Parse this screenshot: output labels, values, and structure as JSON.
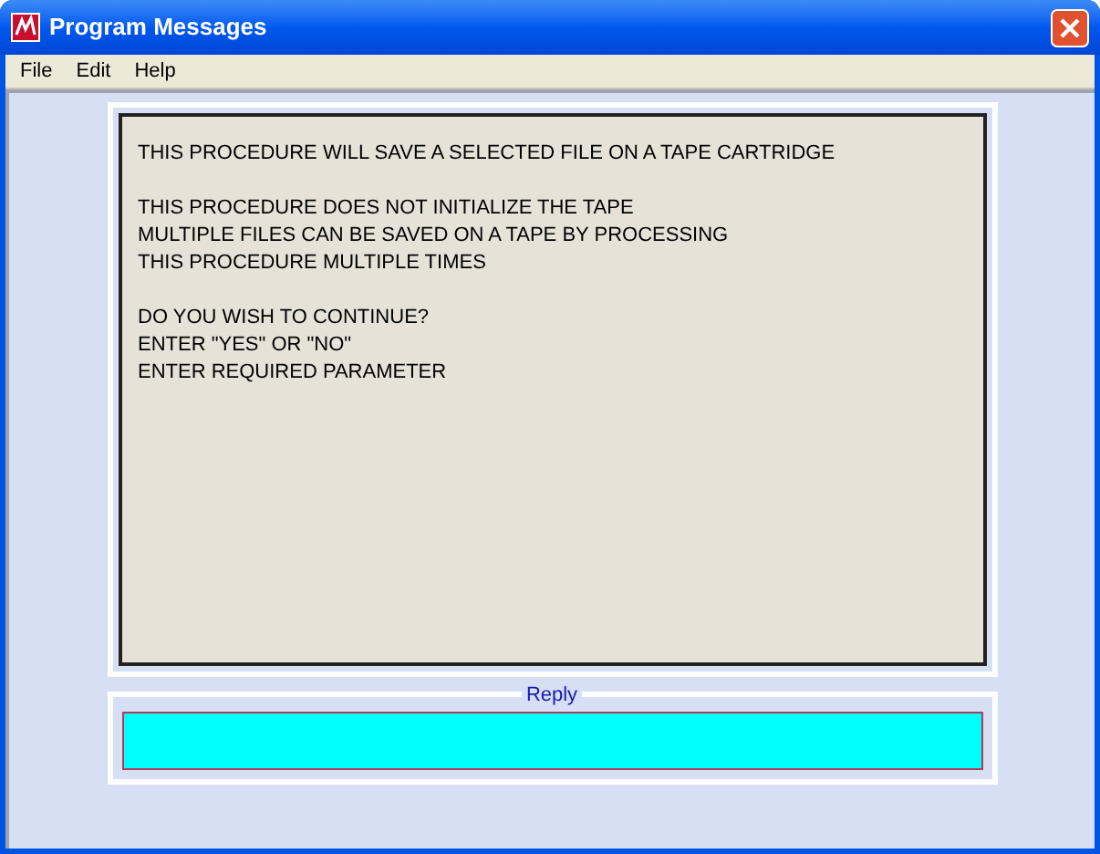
{
  "window": {
    "title": "Program Messages"
  },
  "menu": [
    {
      "label": "File"
    },
    {
      "label": "Edit"
    },
    {
      "label": "Help"
    }
  ],
  "message": {
    "paragraphs": [
      [
        "THIS PROCEDURE WILL SAVE A SELECTED FILE ON A TAPE CARTRIDGE"
      ],
      [
        "THIS PROCEDURE DOES NOT INITIALIZE THE TAPE",
        "MULTIPLE FILES CAN BE SAVED ON A TAPE BY PROCESSING",
        "THIS PROCEDURE MULTIPLE TIMES"
      ],
      [
        "DO YOU WISH TO CONTINUE?",
        "ENTER \"YES\" OR \"NO\"",
        "ENTER REQUIRED PARAMETER"
      ]
    ]
  },
  "reply": {
    "label": "Reply"
  }
}
